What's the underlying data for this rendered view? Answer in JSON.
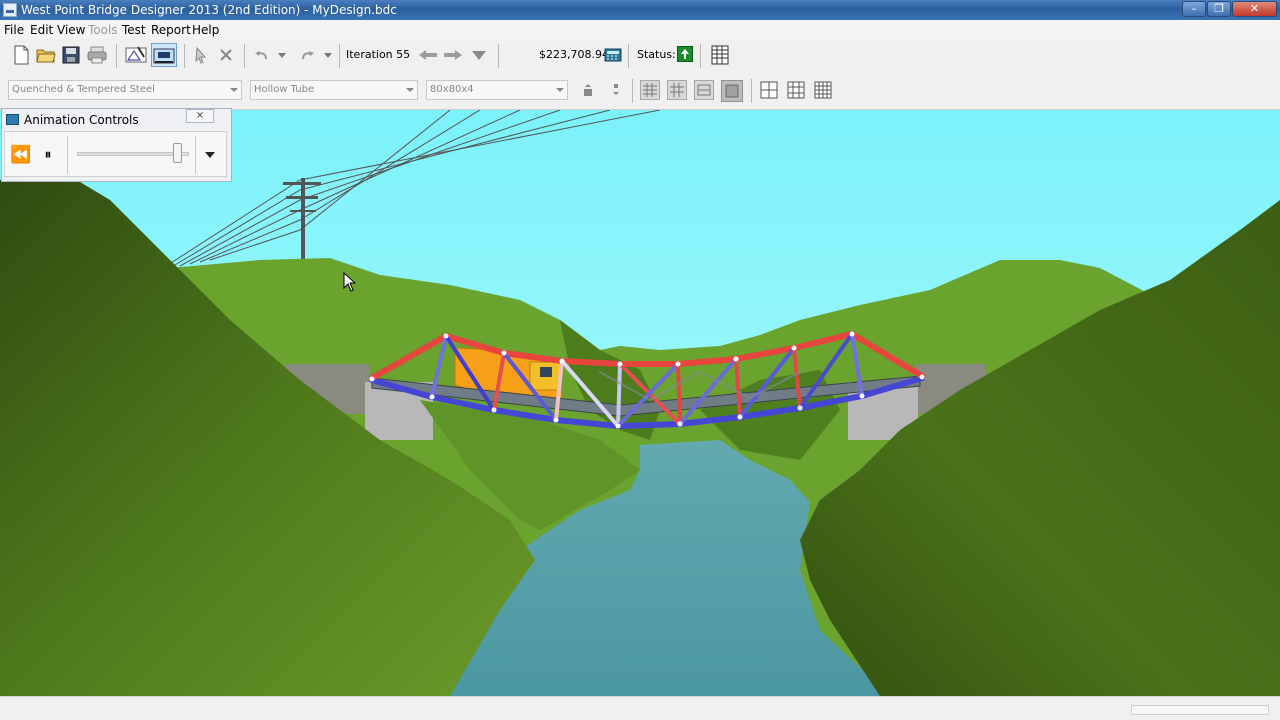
{
  "window": {
    "title": "West Point Bridge Designer 2013 (2nd Edition) - MyDesign.bdc",
    "min_glyph": "–",
    "max_glyph": "❐",
    "close_glyph": "✕"
  },
  "menu": {
    "file": "File",
    "edit": "Edit",
    "view": "View",
    "tools": "Tools",
    "test": "Test",
    "report": "Report",
    "help": "Help"
  },
  "toolbar": {
    "iteration_label": "Iteration 55",
    "cost": "$223,708.94",
    "status_label": "Status:",
    "icons": [
      "new-file-icon",
      "open-folder-icon",
      "save-icon",
      "print-icon",
      "drawing-board-icon",
      "load-test-icon",
      "select-icon",
      "delete-icon",
      "undo-icon",
      "redo-icon",
      "back-arrow-icon",
      "forward-arrow-icon",
      "iteration-dropdown-icon",
      "cost-calculator-icon",
      "status-up-icon",
      "cost-report-icon"
    ]
  },
  "member_properties": {
    "material": "Quenched & Tempered Steel",
    "section": "Hollow Tube",
    "size": "80x80x4"
  },
  "animation_controls": {
    "title": "Animation Controls",
    "close_glyph": "⨯",
    "rewind_glyph": "⏪",
    "pause_glyph": "⏸",
    "speed_level": 0.93
  },
  "colors": {
    "sky": "#8ef6fb",
    "hills": "#5e9a28",
    "water": "#4f9aa4",
    "compression": "#e8453e",
    "tension": "#4a4ad8",
    "deck": "#6f7a82"
  }
}
